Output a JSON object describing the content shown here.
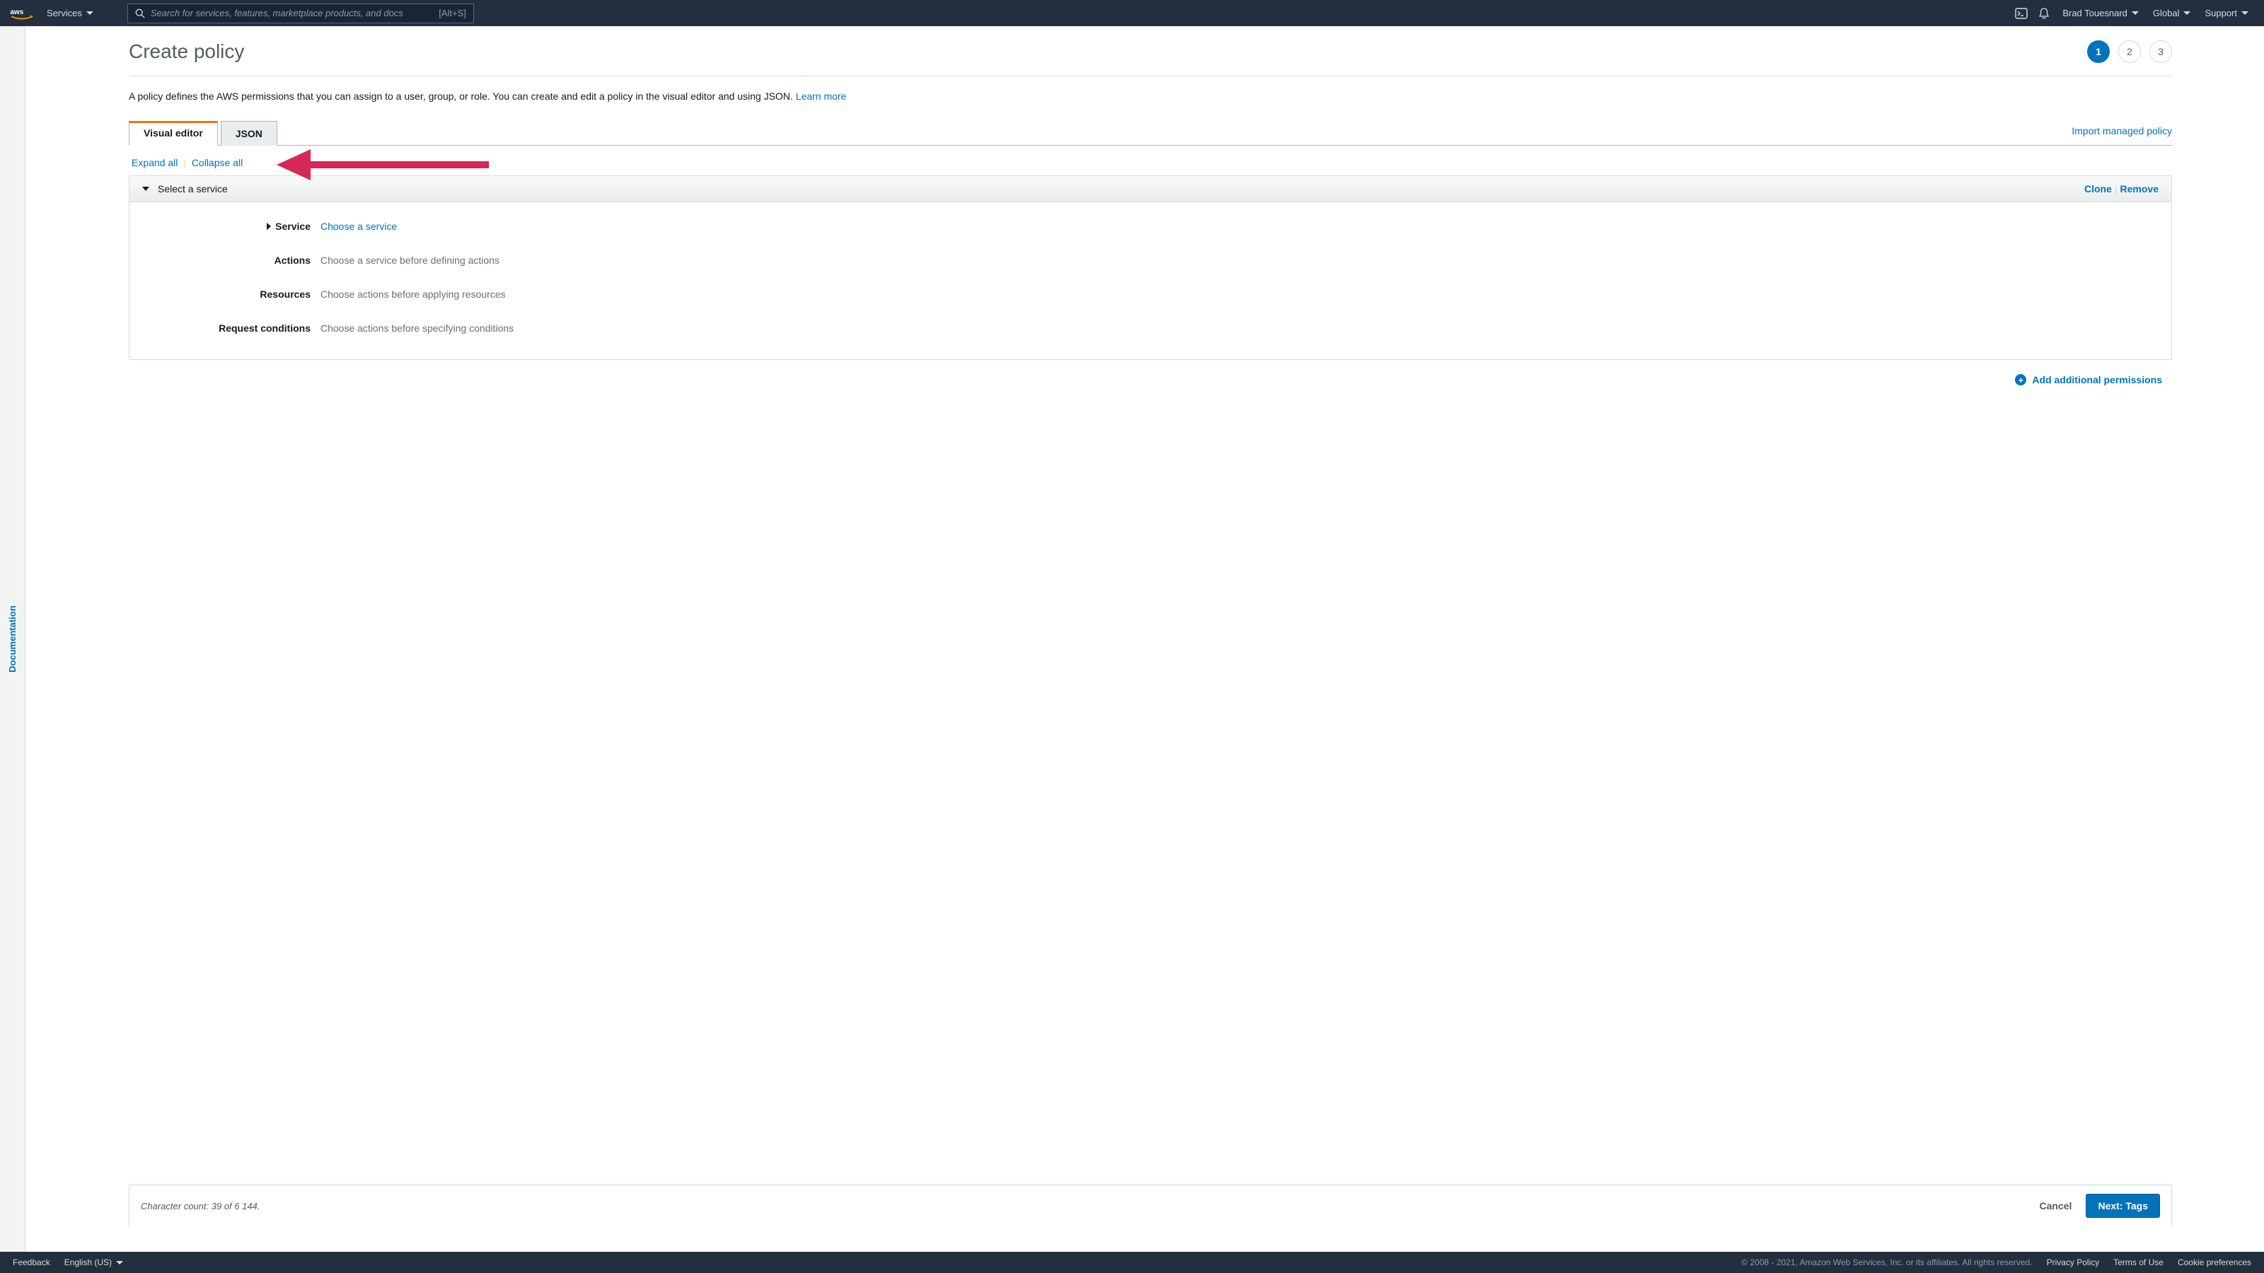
{
  "topnav": {
    "services": "Services",
    "search_placeholder": "Search for services, features, marketplace products, and docs",
    "search_kbd": "[Alt+S]",
    "user": "Brad Touesnard",
    "region": "Global",
    "support": "Support"
  },
  "sidebar": {
    "documentation": "Documentation"
  },
  "header": {
    "title": "Create policy",
    "steps": [
      "1",
      "2",
      "3"
    ],
    "active_step": 0
  },
  "description": {
    "text": "A policy defines the AWS permissions that you can assign to a user, group, or role. You can create and edit a policy in the visual editor and using JSON. ",
    "learn_more": "Learn more"
  },
  "tabs": {
    "visual": "Visual editor",
    "json": "JSON",
    "import": "Import managed policy"
  },
  "controls": {
    "expand_all": "Expand all",
    "collapse_all": "Collapse all"
  },
  "service_block": {
    "header_title": "Select a service",
    "clone": "Clone",
    "remove": "Remove",
    "rows": {
      "service": {
        "label": "Service",
        "value": "Choose a service"
      },
      "actions": {
        "label": "Actions",
        "value": "Choose a service before defining actions"
      },
      "resources": {
        "label": "Resources",
        "value": "Choose actions before applying resources"
      },
      "conditions": {
        "label": "Request conditions",
        "value": "Choose actions before specifying conditions"
      }
    }
  },
  "add_permissions": "Add additional permissions",
  "action_bar": {
    "char_count": "Character count: 39 of 6 144.",
    "cancel": "Cancel",
    "next": "Next: Tags"
  },
  "footer": {
    "feedback": "Feedback",
    "language": "English (US)",
    "copyright": "© 2008 - 2021, Amazon Web Services, Inc. or its affiliates. All rights reserved.",
    "privacy": "Privacy Policy",
    "terms": "Terms of Use",
    "cookies": "Cookie preferences"
  }
}
